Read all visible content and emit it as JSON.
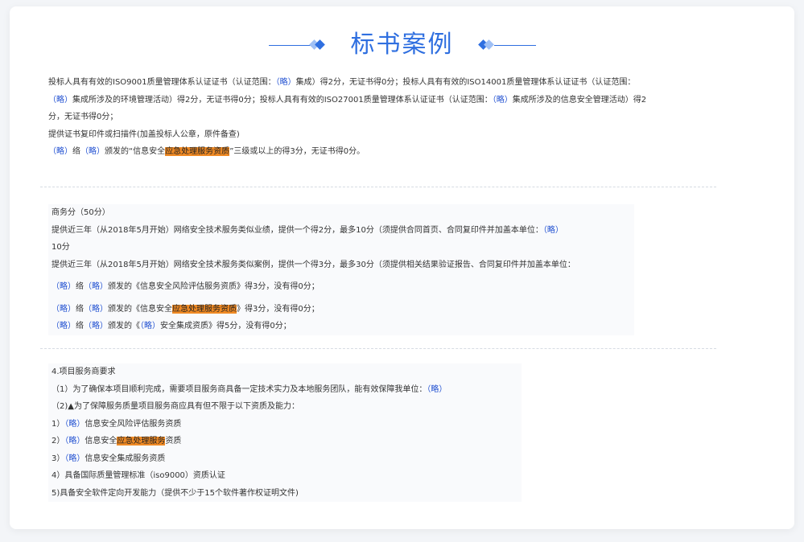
{
  "title": "标书案例",
  "section1": {
    "line1_a": "投标人具有有效的ISO9001质量管理体系认证证书（认证范围：",
    "line1_b": "（略）",
    "line1_c": "集成）得2分，无证书得0分；投标人具有有效的ISO14001质量管理体系认证证书（认证范围：",
    "line1_d": "（略）",
    "line1_e": "集成所涉及的环境管理活动）得2分，无证书得0分；投标人具有有效的ISO27001质量管理体系认证证书（认证范围：",
    "line1_f": "（略）",
    "line1_g": "集成所涉及的信息安全管理活动）得2分，无证书得0分；",
    "line2": "提供证书复印件或扫描件(加盖投标人公章，原件备查)",
    "line3_a": "（略）",
    "line3_b": "络",
    "line3_c": "（略）",
    "line3_d": "颁发的“信息安全",
    "line3_hl": "应急处理服务资质",
    "line3_e": "”三级或以上的得3分，无证书得0分。"
  },
  "section2": {
    "line1": "商务分（50分）",
    "line2_a": "提供近三年（从2018年5月开始）网络安全技术服务类似业绩，提供一个得2分，最多10分（须提供合同首页、合同复印件并加盖本单位：",
    "line2_b": "（略）",
    "line2_c": "10分",
    "line3": "提供近三年（从2018年5月开始）网络安全技术服务类似案例，提供一个得3分，最多30分（须提供相关结果验证报告、合同复印件并加盖本单位：",
    "line4_a": "（略）",
    "line4_b": "络",
    "line4_c": "（略）",
    "line4_d": "颁发的《信息安全风险评估服务资质》得3分，没有得0分；",
    "line5_a": "（略）",
    "line5_b": "络",
    "line5_c": "（略）",
    "line5_d": "颁发的《信息安全",
    "line5_hl": "应急处理服务资质",
    "line5_e": "》得3分，没有得0分；",
    "line6_a": "（略）",
    "line6_b": "络",
    "line6_c": "（略）",
    "line6_d": "颁发的《",
    "line6_e": "（略）",
    "line6_f": "安全集成资质》得5分，没有得0分；"
  },
  "section3": {
    "line1": "4.项目服务商要求",
    "line2_a": "（1）为了确保本项目顺利完成，需要项目服务商具备一定技术实力及本地服务团队，能有效保障我单位：",
    "line2_b": "（略）",
    "line3": "（2)▲为了保障服务质量项目服务商应具有但不限于以下资质及能力：",
    "line4_a": "1）",
    "line4_b": "（略）",
    "line4_c": "信息安全风险评估服务资质",
    "line5_a": "2）",
    "line5_b": "（略）",
    "line5_c": "信息安全",
    "line5_hl": "应急处理服务",
    "line5_d": "资质",
    "line6_a": "3）",
    "line6_b": "（略）",
    "line6_c": "信息安全集成服务资质",
    "line7": "4）具备国际质量管理标准（iso9000）资质认证",
    "line8": "5)具备安全软件定向开发能力（提供不少于15个软件著作权证明文件)"
  }
}
